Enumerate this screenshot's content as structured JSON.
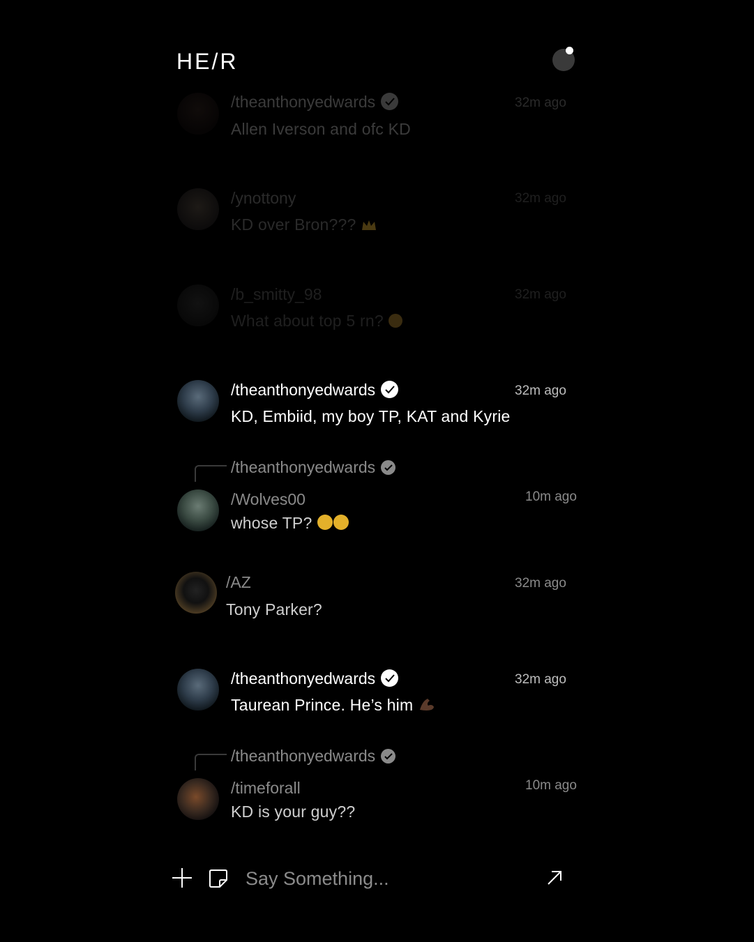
{
  "app": {
    "logo": "HE/R"
  },
  "messages": [
    {
      "user": "/theanthonyedwards",
      "verified": true,
      "text": "Allen Iverson and ofc KD",
      "time": "32m ago",
      "emoji": "",
      "avatar_icon": "profile-photo"
    },
    {
      "user": "/ynottony",
      "verified": false,
      "text": "KD over Bron???",
      "time": "32m ago",
      "emoji": "crown",
      "avatar_icon": "bear-avatar"
    },
    {
      "user": "/b_smitty_98",
      "verified": false,
      "text": "What about top 5 rn?",
      "time": "32m ago",
      "emoji": "flushed-face",
      "avatar_icon": "profile-photo"
    },
    {
      "user": "/theanthonyedwards",
      "verified": true,
      "text": "KD, Embiid, my boy TP, KAT and Kyrie",
      "time": "32m ago",
      "emoji": "",
      "avatar_icon": "profile-photo"
    },
    {
      "reply_to": "/theanthonyedwards",
      "user": "/Wolves00",
      "verified": false,
      "text": "whose TP?",
      "time": "10m ago",
      "emoji": "thinking-face x2",
      "avatar_icon": "profile-photo"
    },
    {
      "user": "/AZ",
      "verified": false,
      "text": "Tony Parker?",
      "time": "32m ago",
      "emoji": "",
      "avatar_icon": "profile-photo"
    },
    {
      "user": "/theanthonyedwards",
      "verified": true,
      "text": "Taurean Prince. He’s him",
      "time": "32m ago",
      "emoji": "flexed-biceps",
      "avatar_icon": "profile-photo"
    },
    {
      "reply_to": "/theanthonyedwards",
      "user": "/timeforall",
      "verified": false,
      "text": "KD is your guy??",
      "time": "10m ago",
      "emoji": "",
      "avatar_icon": "profile-photo"
    }
  ],
  "composer": {
    "placeholder": "Say Something..."
  },
  "colors": {
    "background": "#000000",
    "text": "#ffffff",
    "muted": "#8a8a8a",
    "badge": "#ffffff"
  }
}
